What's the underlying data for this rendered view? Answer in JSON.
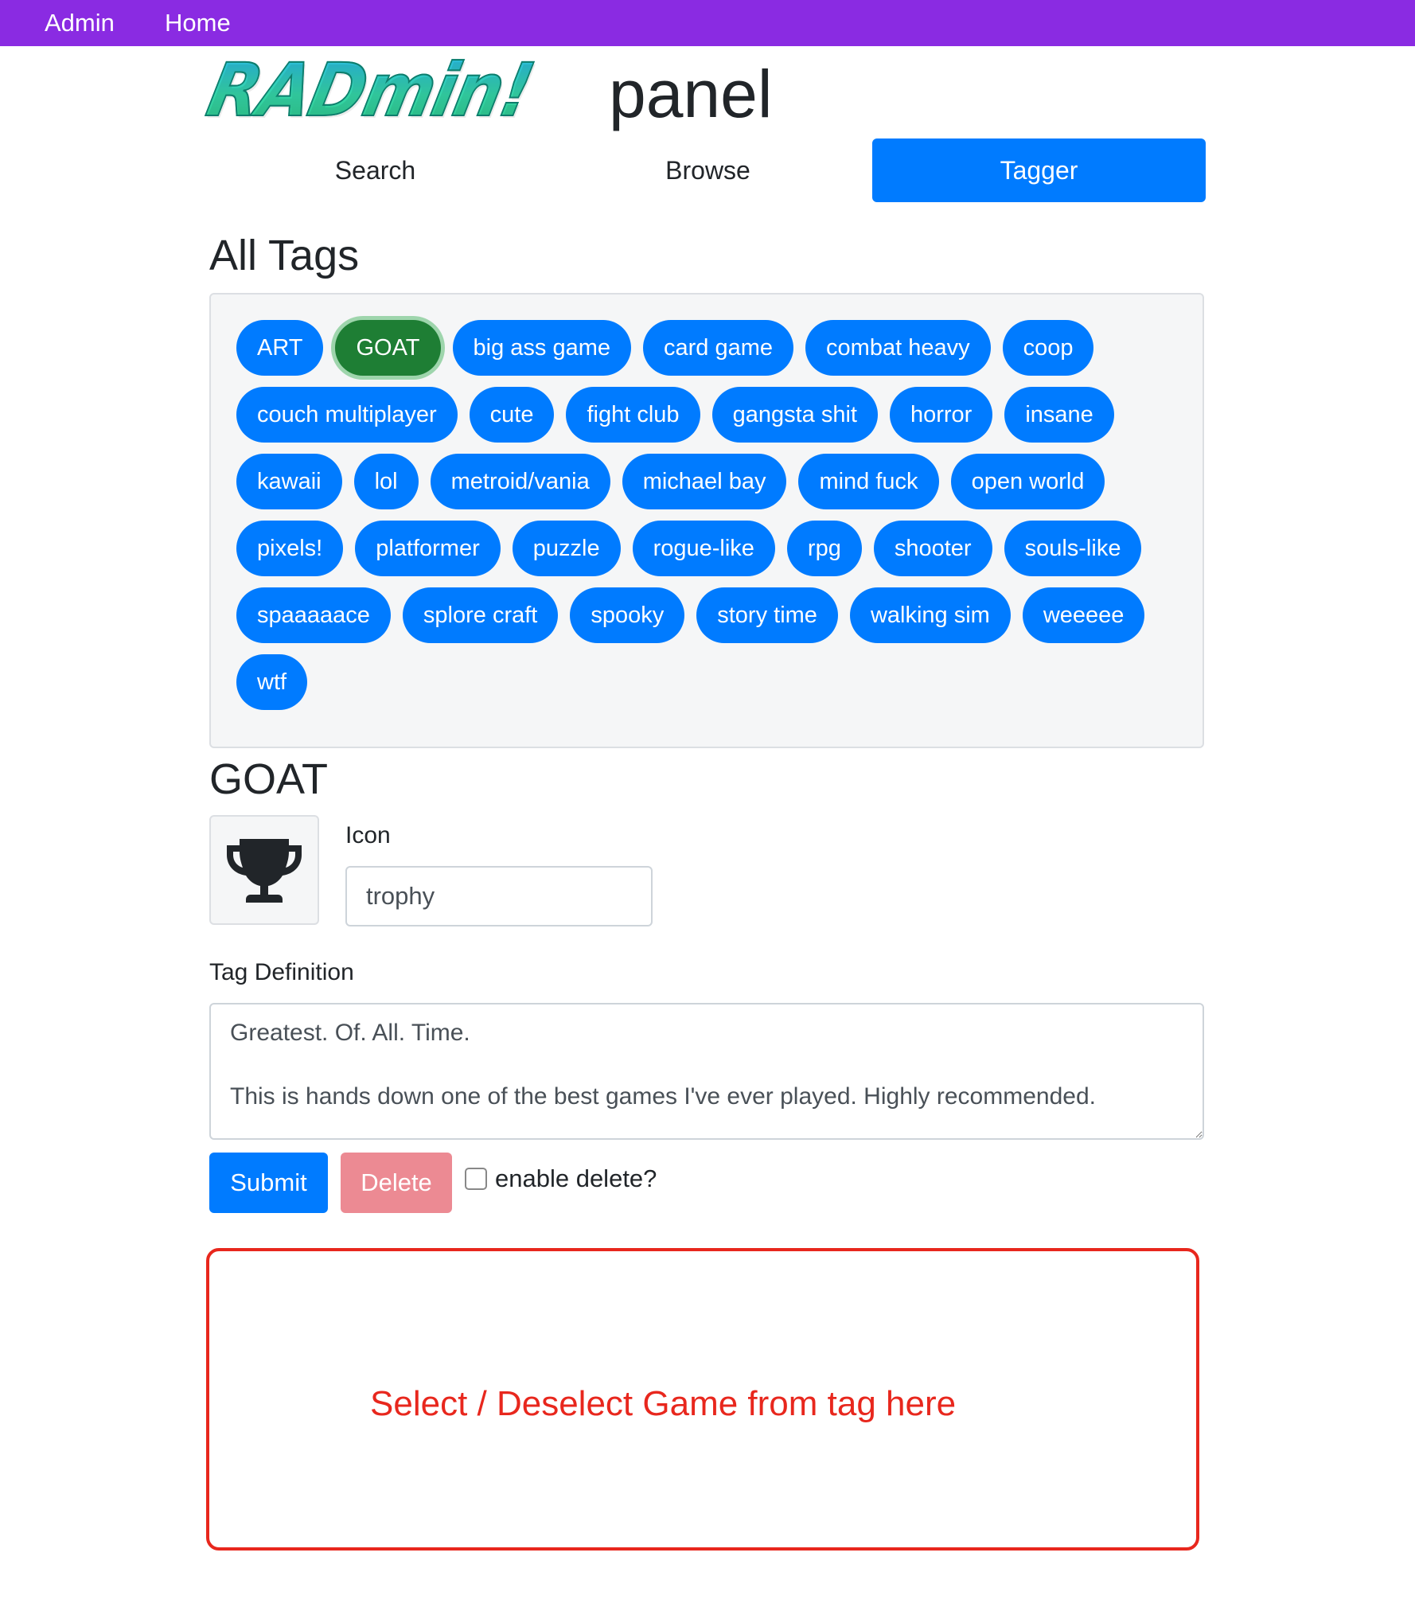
{
  "navbar": {
    "admin": "Admin",
    "home": "Home"
  },
  "header": {
    "logo_text": "RADmin!",
    "suffix": "panel"
  },
  "tabs": [
    {
      "label": "Search",
      "active": false
    },
    {
      "label": "Browse",
      "active": false
    },
    {
      "label": "Tagger",
      "active": true
    }
  ],
  "all_tags": {
    "heading": "All Tags",
    "selected": "GOAT",
    "tags": [
      "ART",
      "GOAT",
      "big ass game",
      "card game",
      "combat heavy",
      "coop",
      "couch multiplayer",
      "cute",
      "fight club",
      "gangsta shit",
      "horror",
      "insane",
      "kawaii",
      "lol",
      "metroid/vania",
      "michael bay",
      "mind fuck",
      "open world",
      "pixels!",
      "platformer",
      "puzzle",
      "rogue-like",
      "rpg",
      "shooter",
      "souls-like",
      "spaaaaace",
      "splore craft",
      "spooky",
      "story time",
      "walking sim",
      "weeeee",
      "wtf"
    ]
  },
  "tag_editor": {
    "title": "GOAT",
    "icon_name": "trophy-icon",
    "icon_label": "Icon",
    "icon_value": "trophy",
    "definition_label": "Tag Definition",
    "definition_value": "Greatest. Of. All. Time.\n\nThis is hands down one of the best games I've ever played. Highly recommended.",
    "submit_label": "Submit",
    "delete_label": "Delete",
    "enable_delete_label": "enable delete?",
    "enable_delete_checked": false
  },
  "game_selector": {
    "placeholder": "Select / Deselect Game from tag here"
  },
  "colors": {
    "navbar": "#8a2be2",
    "primary": "#007bff",
    "selected_tag": "#1e7e34",
    "delete_disabled": "#ec8a93",
    "drop_zone": "#e8271d"
  }
}
